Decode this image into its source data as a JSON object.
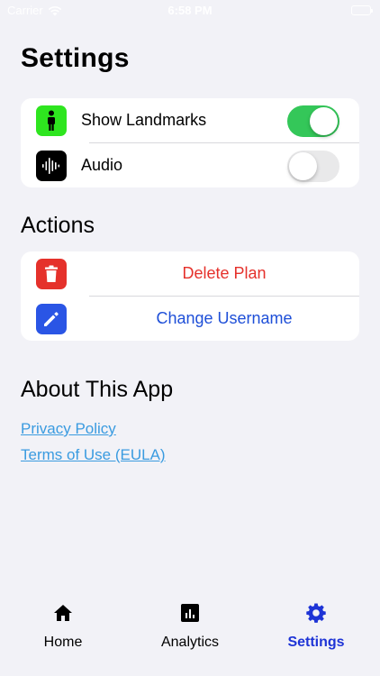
{
  "status_bar": {
    "carrier": "Carrier",
    "time": "6:58 PM"
  },
  "page_title": "Settings",
  "settings": {
    "rows": [
      {
        "label": "Show Landmarks",
        "icon": "person-landmark-icon",
        "icon_bg": "#2ee51f",
        "toggle_on": true
      },
      {
        "label": "Audio",
        "icon": "waveform-icon",
        "icon_bg": "#000000",
        "toggle_on": false
      }
    ]
  },
  "actions": {
    "header": "Actions",
    "delete": {
      "label": "Delete Plan",
      "color": "#e5312b",
      "icon": "trash-icon"
    },
    "change": {
      "label": "Change Username",
      "color": "#1e4fd8",
      "icon": "pencil-icon"
    }
  },
  "about": {
    "header": "About This App",
    "privacy": "Privacy Policy",
    "terms": "Terms of Use (EULA)"
  },
  "tabs": [
    {
      "label": "Home",
      "icon": "house-icon"
    },
    {
      "label": "Analytics",
      "icon": "chart-bar-icon"
    },
    {
      "label": "Settings",
      "icon": "gear-icon",
      "active": true
    }
  ],
  "colors": {
    "accent": "#1e34d6",
    "toggle_on": "#34c759",
    "link": "#3a9be0"
  }
}
